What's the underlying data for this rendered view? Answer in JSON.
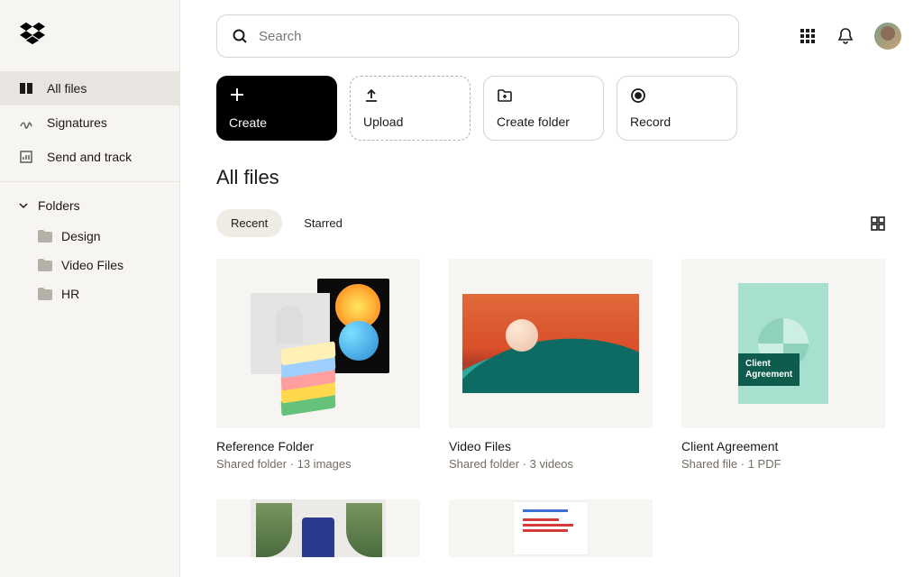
{
  "search": {
    "placeholder": "Search"
  },
  "nav": {
    "all_files": "All files",
    "signatures": "Signatures",
    "send_track": "Send and track"
  },
  "folders": {
    "header": "Folders",
    "items": [
      "Design",
      "Video Files",
      "HR"
    ]
  },
  "actions": {
    "create": "Create",
    "upload": "Upload",
    "create_folder": "Create folder",
    "record": "Record"
  },
  "page": {
    "title": "All files"
  },
  "filters": {
    "recent": "Recent",
    "starred": "Starred"
  },
  "cards": [
    {
      "title": "Reference Folder",
      "sub": "Shared folder · 13 images"
    },
    {
      "title": "Video Files",
      "sub": "Shared folder · 3 videos"
    },
    {
      "title": "Client Agreement",
      "sub": "Shared file · 1 PDF",
      "doc_label": "Client\nAgreement"
    }
  ]
}
